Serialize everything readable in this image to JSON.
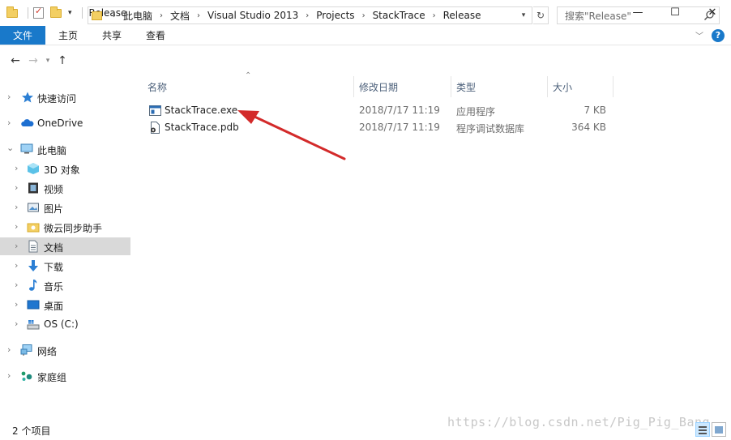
{
  "window": {
    "title": "Release",
    "minimize": "—",
    "maximize": "☐",
    "close": "✕"
  },
  "ribbon": {
    "tabs": [
      "文件",
      "主页",
      "共享",
      "查看"
    ],
    "help": "?"
  },
  "address": {
    "breadcrumbs": [
      "此电脑",
      "文档",
      "Visual Studio 2013",
      "Projects",
      "StackTrace",
      "Release"
    ],
    "search_placeholder": "搜索\"Release\""
  },
  "navigation": [
    {
      "label": "快速访问",
      "icon": "star-icon",
      "level": 0
    },
    {
      "label": "OneDrive",
      "icon": "cloud-icon",
      "level": 0
    },
    {
      "label": "此电脑",
      "icon": "computer-icon",
      "level": 0,
      "expanded": true
    },
    {
      "label": "3D 对象",
      "icon": "cube-icon",
      "level": 1
    },
    {
      "label": "视频",
      "icon": "film-icon",
      "level": 1
    },
    {
      "label": "图片",
      "icon": "picture-icon",
      "level": 1
    },
    {
      "label": "微云同步助手",
      "icon": "sync-folder-icon",
      "level": 1
    },
    {
      "label": "文档",
      "icon": "document-icon",
      "level": 1,
      "selected": true
    },
    {
      "label": "下载",
      "icon": "download-icon",
      "level": 1
    },
    {
      "label": "音乐",
      "icon": "music-icon",
      "level": 1
    },
    {
      "label": "桌面",
      "icon": "desktop-icon",
      "level": 1
    },
    {
      "label": "OS (C:)",
      "icon": "drive-icon",
      "level": 1
    },
    {
      "label": "网络",
      "icon": "network-icon",
      "level": 0
    },
    {
      "label": "家庭组",
      "icon": "homegroup-icon",
      "level": 0
    }
  ],
  "columns": {
    "name": "名称",
    "date": "修改日期",
    "type": "类型",
    "size": "大小"
  },
  "files": [
    {
      "name": "StackTrace.exe",
      "date": "2018/7/17 11:19",
      "type": "应用程序",
      "size": "7 KB",
      "icon": "exe-icon"
    },
    {
      "name": "StackTrace.pdb",
      "date": "2018/7/17 11:19",
      "type": "程序调试数据库",
      "size": "364 KB",
      "icon": "pdb-icon"
    }
  ],
  "status": {
    "item_count": "2 个项目",
    "watermark": "https://blog.csdn.net/Pig_Pig_Bang"
  },
  "colors": {
    "accent": "#1979ca",
    "selected_nav": "#d9d9d9",
    "annotation_arrow": "#d32a2a"
  }
}
